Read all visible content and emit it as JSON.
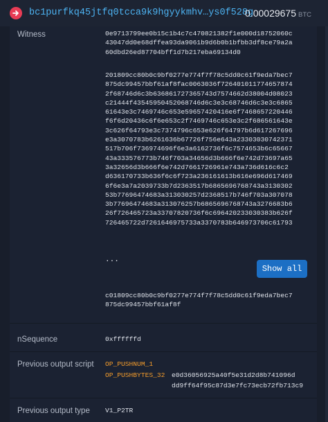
{
  "header": {
    "address": "bc1purfkq45jtfq0tcca9k9hgyykmhv…ys0f528g",
    "amount": "0.00029675",
    "unit": "BTC",
    "icon": "arrow-right-icon",
    "icon_color": "#e83c55",
    "link_color": "#4db3f2"
  },
  "witness": {
    "label": "Witness",
    "items": [
      "0e9713799ee0b15c1b4c7c470821382f1e000d18752060c\n43047dd0e68dffea93da9061b9d6b0b1bfbb3df8ce79a2a\n60dbd26ed87704bff1d7b217eba69134d0",
      "201809cc80b0c9bf0277e774f7f78c5dd0c61f9eda7bec7\n875dc99457bbf61af8fac0063036f726401011774657874\n2f68746d6c3b636861727365743d7574662d38004d08023\nc21444f43545950452068746d6c3e3c68746d6c3e3c6865\n61643e3c7469746c653e59657420416e6f7468657220446\nf6f6d20436c6f6e653c2f7469746c653e3c2f686561643e\n3c626f64793e3c7374796c653e626f64797b6d617267696\ne3a3070783b6261636b67726f756e643a23303030742371\n517b706f736974696f6e3a6162736f6c7574653b6c65667\n43a333576773b746f703a34656d3b666f6e742d73697a65\n3a32656d3b666f6e742d7661726961e743a736d616c6c2\nd636170733b636f6c6f723a236161613b616e696d617469\n6f6e3a7a2039733b7d2363517b6865696768743a3130302\n53b77696474683a313030257d2368517b746f703a307078\n3b77696474683a313076257b6865696768743a3276683b6\n26f726465723a33707820736f6c696420233030383b626f\n726465722d7261646975733a3370783b646973706c61793",
      "c01809cc80b0c9bf0277e774f7f78c5dd0c61f9eda7bec7\n875dc99457bbf61af8f"
    ],
    "ellipsis": "...",
    "show_all_label": "Show all"
  },
  "nsequence": {
    "label": "nSequence",
    "value": "0xffffffd"
  },
  "prev_script": {
    "label": "Previous output script",
    "op1": "OP_PUSHNUM_1",
    "op2": "OP_PUSHBYTES_32",
    "data": "e0d36056925a40f5e31d2d8b741096d\ndd9ff64f95c87d3e7fc73ecb72fb713c9"
  },
  "prev_type": {
    "label": "Previous output type",
    "value": "V1_P2TR"
  }
}
